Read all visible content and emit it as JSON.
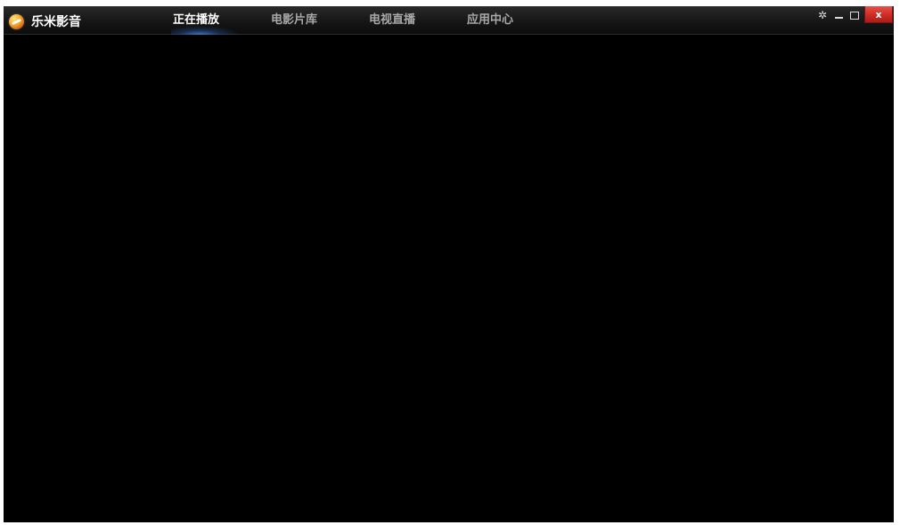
{
  "app": {
    "title": "乐米影音"
  },
  "nav": {
    "tabs": [
      {
        "label": "正在播放",
        "active": true
      },
      {
        "label": "电影片库",
        "active": false
      },
      {
        "label": "电视直播",
        "active": false
      },
      {
        "label": "应用中心",
        "active": false
      }
    ]
  },
  "window_controls": {
    "settings_icon": "gear-icon",
    "minimize_icon": "minimize-icon",
    "maximize_icon": "maximize-icon",
    "close_label": "x"
  },
  "colors": {
    "accent": "#4696f0",
    "close": "#c92a22",
    "background": "#000000"
  }
}
